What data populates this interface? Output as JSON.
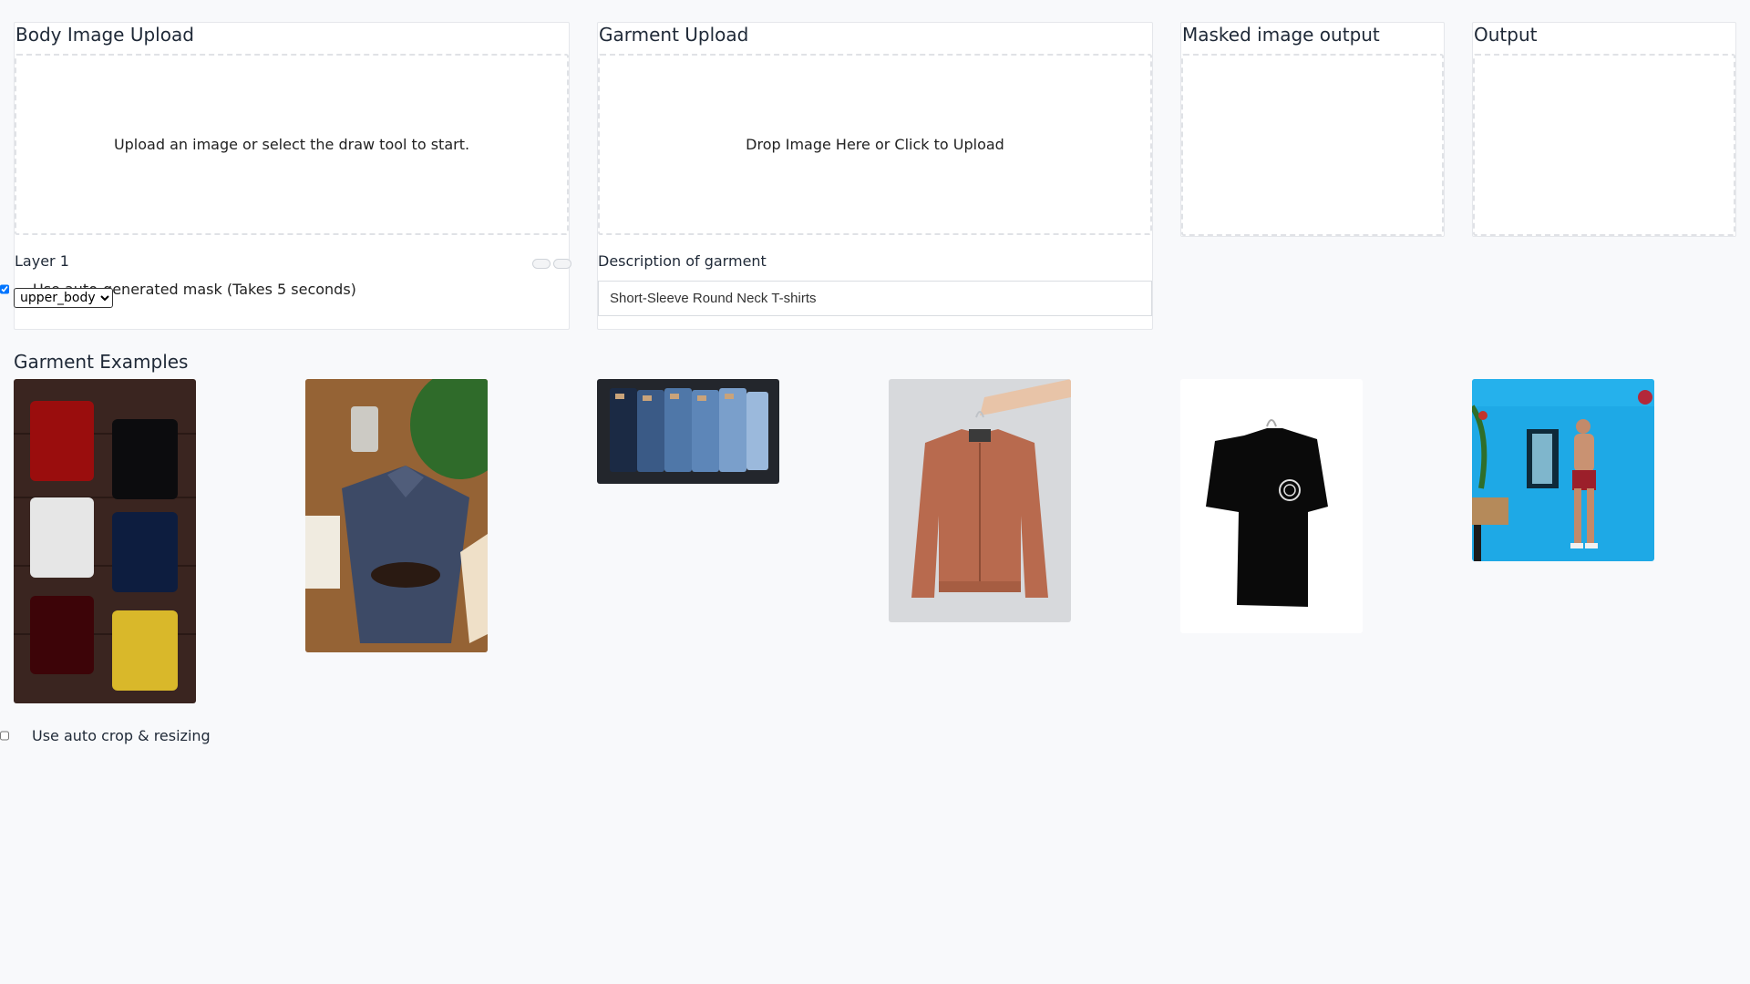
{
  "body_panel": {
    "title": "Body Image Upload",
    "dropzone_text": "Upload an image or select the draw tool to start.",
    "layer_label": "Layer 1",
    "auto_mask_label": "Use auto-generated mask (Takes 5 seconds)",
    "auto_mask_checked": true,
    "region_select": {
      "selected": "upper_body"
    }
  },
  "garment_panel": {
    "title": "Garment Upload",
    "dropzone_text": "Drop Image Here or Click to Upload",
    "description_label": "Description of garment",
    "description_value": "Short-Sleeve Round Neck T-shirts"
  },
  "masked_panel": {
    "title": "Masked image output"
  },
  "output_panel": {
    "title": "Output"
  },
  "examples": {
    "title": "Garment Examples",
    "items": [
      {
        "name": "folded-tshirts-grid"
      },
      {
        "name": "denim-shirt-flatlay"
      },
      {
        "name": "stacked-jeans"
      },
      {
        "name": "bomber-jacket-hanger"
      },
      {
        "name": "black-tshirt-hanger"
      },
      {
        "name": "man-blue-wall"
      }
    ]
  },
  "auto_crop": {
    "label": "Use auto crop & resizing",
    "checked": false
  }
}
